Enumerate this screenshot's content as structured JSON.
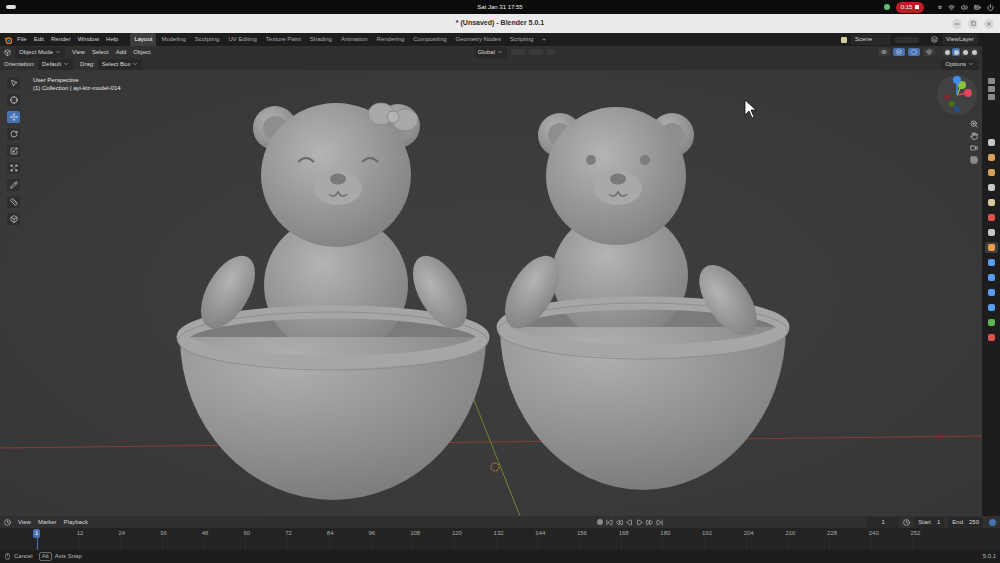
{
  "system_bar": {
    "clock": "Sat Jan 31 17:55",
    "recording": "0:15",
    "keyboard_layout": "tr"
  },
  "window": {
    "title": "* (Unsaved) - Blender 5.0.1"
  },
  "menus": [
    "File",
    "Edit",
    "Render",
    "Window",
    "Help"
  ],
  "workspaces": [
    {
      "label": "Layout",
      "selected": true
    },
    {
      "label": "Modeling",
      "selected": false
    },
    {
      "label": "Sculpting",
      "selected": false
    },
    {
      "label": "UV Editing",
      "selected": false
    },
    {
      "label": "Texture Paint",
      "selected": false
    },
    {
      "label": "Shading",
      "selected": false
    },
    {
      "label": "Animation",
      "selected": false
    },
    {
      "label": "Rendering",
      "selected": false
    },
    {
      "label": "Compositing",
      "selected": false
    },
    {
      "label": "Geometry Nodes",
      "selected": false
    },
    {
      "label": "Scripting",
      "selected": false
    }
  ],
  "add_workspace": "+",
  "scene": "Scene",
  "view_layer": "ViewLayer",
  "viewport_header": {
    "mode": "Object Mode",
    "menus": [
      "View",
      "Select",
      "Add",
      "Object"
    ],
    "transform_orientation": "Global",
    "toggles": [
      {
        "selected": false
      },
      {
        "selected": true
      },
      {
        "selected": true
      },
      {
        "selected": false
      }
    ],
    "shading": [
      {
        "selected": false
      },
      {
        "selected": true
      },
      {
        "selected": false
      },
      {
        "selected": false
      }
    ]
  },
  "tool_settings": {
    "orientation_label": "Orientation:",
    "orientation": "Default",
    "drag_label": "Drag:",
    "drag": "Select Box",
    "options": "Options"
  },
  "toolbar": [
    {
      "kind": "select",
      "selected": false
    },
    {
      "kind": "cursor",
      "selected": false
    },
    {
      "kind": "move",
      "selected": true
    },
    {
      "kind": "rotate",
      "selected": false
    },
    {
      "kind": "scale",
      "selected": false
    },
    {
      "kind": "transform",
      "selected": false
    },
    {
      "kind": "annotate",
      "selected": false
    },
    {
      "kind": "measure",
      "selected": false
    },
    {
      "kind": "add",
      "selected": false
    }
  ],
  "viewport": {
    "perspective": "User Perspective",
    "collection": "(1) Collection | ayi-kiz-model-014"
  },
  "property_tabs": [
    {
      "color": "#c8c8c8",
      "selected": false
    },
    {
      "color": "#d6a35c",
      "selected": false
    },
    {
      "color": "#d6a35c",
      "selected": false
    },
    {
      "color": "#c8c8c8",
      "selected": false
    },
    {
      "color": "#d9c9a3",
      "selected": false
    },
    {
      "color": "#d9534f",
      "selected": false
    },
    {
      "color": "#c8c8c8",
      "selected": false
    },
    {
      "color": "#e8a049",
      "selected": true
    },
    {
      "color": "#5a9cf0",
      "selected": false
    },
    {
      "color": "#5a9cf0",
      "selected": false
    },
    {
      "color": "#5a9cf0",
      "selected": false
    },
    {
      "color": "#5a9cf0",
      "selected": false
    },
    {
      "color": "#62b454",
      "selected": false
    },
    {
      "color": "#d9534f",
      "selected": false
    }
  ],
  "timeline": {
    "menus": [
      "View",
      "Marker",
      "Playback"
    ],
    "current_frame": "1",
    "start_label": "Start",
    "start": "1",
    "end_label": "End",
    "end": "250",
    "ticks": [
      {
        "label": "1",
        "selected": true
      },
      {
        "label": "12",
        "selected": false
      },
      {
        "label": "24",
        "selected": false
      },
      {
        "label": "36",
        "selected": false
      },
      {
        "label": "48",
        "selected": false
      },
      {
        "label": "60",
        "selected": false
      },
      {
        "label": "72",
        "selected": false
      },
      {
        "label": "84",
        "selected": false
      },
      {
        "label": "96",
        "selected": false
      },
      {
        "label": "108",
        "selected": false
      },
      {
        "label": "120",
        "selected": false
      },
      {
        "label": "132",
        "selected": false
      },
      {
        "label": "144",
        "selected": false
      },
      {
        "label": "156",
        "selected": false
      },
      {
        "label": "168",
        "selected": false
      },
      {
        "label": "180",
        "selected": false
      },
      {
        "label": "192",
        "selected": false
      },
      {
        "label": "204",
        "selected": false
      },
      {
        "label": "216",
        "selected": false
      },
      {
        "label": "228",
        "selected": false
      },
      {
        "label": "240",
        "selected": false
      },
      {
        "label": "252",
        "selected": false
      }
    ]
  },
  "status_bar": {
    "hints": [
      {
        "key": "",
        "label": "Cancel"
      },
      {
        "key": "Alt",
        "label": "Axis Snap"
      }
    ],
    "version": "5.0.1"
  }
}
